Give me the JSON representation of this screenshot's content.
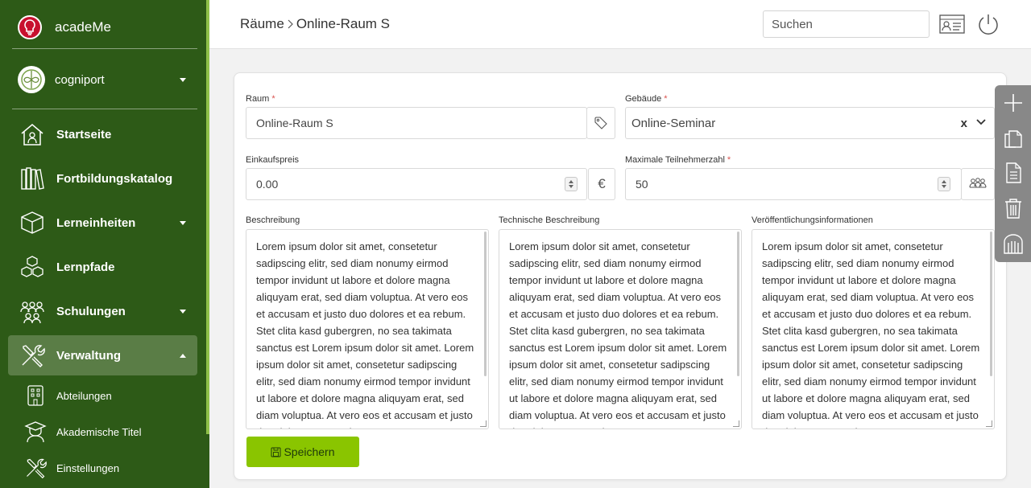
{
  "app": {
    "name": "acadeMe"
  },
  "org": {
    "name": "cogniport"
  },
  "nav": {
    "items": [
      {
        "label": "Startseite",
        "icon": "home-icon"
      },
      {
        "label": "Fortbildungskatalog",
        "icon": "books-icon"
      },
      {
        "label": "Lerneinheiten",
        "icon": "cube-icon"
      },
      {
        "label": "Lernpfade",
        "icon": "cubes-icon"
      },
      {
        "label": "Schulungen",
        "icon": "group-icon"
      },
      {
        "label": "Verwaltung",
        "icon": "tools-icon"
      }
    ],
    "subitems": [
      {
        "label": "Abteilungen",
        "icon": "building-icon"
      },
      {
        "label": "Akademische Titel",
        "icon": "graduate-icon"
      },
      {
        "label": "Einstellungen",
        "icon": "tools-icon"
      }
    ]
  },
  "header": {
    "breadcrumb": [
      "Räume",
      "Online-Raum S"
    ],
    "search_placeholder": "Suchen"
  },
  "form": {
    "raum": {
      "label": "Raum",
      "value": "Online-Raum S"
    },
    "gebaeude": {
      "label": "Gebäude",
      "value": "Online-Seminar",
      "clear": "x"
    },
    "einkaufspreis": {
      "label": "Einkaufspreis",
      "value": "0.00",
      "unit": "€"
    },
    "teilnehmer": {
      "label": "Maximale Teilnehmerzahl",
      "value": "50"
    },
    "required_mark": "*",
    "beschreibung": {
      "label": "Beschreibung"
    },
    "technische": {
      "label": "Technische Beschreibung"
    },
    "veroeffentlichung": {
      "label": "Veröffentlichungsinformationen"
    },
    "lorem": "Lorem ipsum dolor sit amet, consetetur sadipscing elitr, sed diam nonumy eirmod tempor invidunt ut labore et dolore magna aliquyam erat, sed diam voluptua. At vero eos et accusam et justo duo dolores et ea rebum. Stet clita kasd gubergren, no sea takimata sanctus est Lorem ipsum dolor sit amet. Lorem ipsum dolor sit amet, consetetur sadipscing elitr, sed diam nonumy eirmod tempor invidunt ut labore et dolore magna aliquyam erat, sed diam voluptua. At vero eos et accusam et justo duo dolores et ea rebum.",
    "save_label": "Speichern"
  },
  "toolbar": [
    "add-icon",
    "copy-icon",
    "document-icon",
    "trash-icon",
    "archive-icon"
  ],
  "colors": {
    "sidebar": "#2d5a17",
    "accent": "#8ac500",
    "active": "#5a7d46",
    "toolbar": "#888888"
  }
}
